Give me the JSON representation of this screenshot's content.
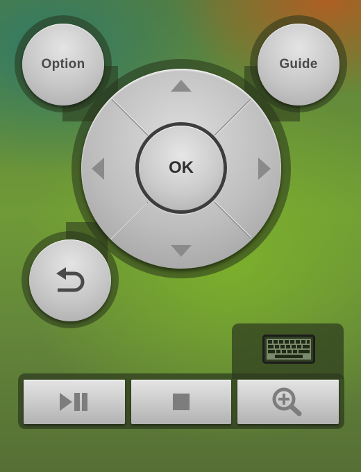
{
  "remote": {
    "option_label": "Option",
    "guide_label": "Guide",
    "ok_label": "OK",
    "back_icon": "back-arrow-icon",
    "dpad": {
      "up_icon": "arrow-up-icon",
      "down_icon": "arrow-down-icon",
      "left_icon": "arrow-left-icon",
      "right_icon": "arrow-right-icon"
    },
    "keyboard_icon": "keyboard-icon",
    "media": [
      {
        "name": "play-pause",
        "icon": "play-pause-icon"
      },
      {
        "name": "stop",
        "icon": "stop-icon"
      },
      {
        "name": "zoom-in",
        "icon": "zoom-in-icon"
      }
    ]
  },
  "colors": {
    "button_face": "#c6c6c6",
    "icon_gray": "#8a8a8a",
    "ok_ring": "#3d3d3d",
    "panel_dark": "#2d3a1e"
  }
}
